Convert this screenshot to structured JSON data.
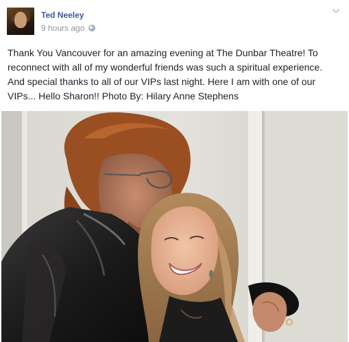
{
  "post": {
    "author": "Ted Neeley",
    "timestamp": "9 hours ago",
    "audience_icon": "globe-icon",
    "options_icon": "chevron-down-icon",
    "message": "Thank You Vancouver for an amazing evening at The Dunbar Theatre! To reconnect with all of my wonderful friends was such a spiritual experience. And special thanks to all of our VIPs last night. Here I am with one of our VIPs... Hello Sharon!! Photo By: Hilary Anne Stephens"
  },
  "colors": {
    "author_link": "#3b5998",
    "meta_text": "#90949c",
    "body_text": "#1d2129"
  }
}
